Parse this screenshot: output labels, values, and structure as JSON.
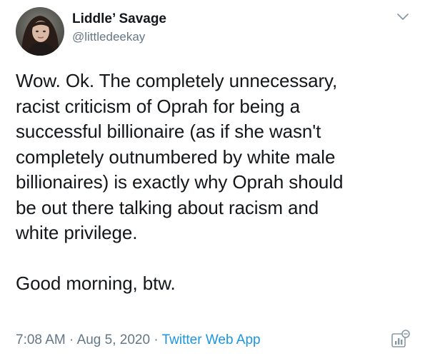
{
  "user": {
    "display_name": "Liddle’ Savage",
    "handle": "@littledeekay",
    "avatar_icon": "avatar-photo"
  },
  "tweet": {
    "lines": [
      "Wow. Ok. The completely unnecessary,",
      "racist criticism of Oprah for being a",
      "successful billionaire (as if she wasn't",
      "completely outnumbered by white male",
      "billionaires) is exactly why Oprah should",
      "be out there talking about racism and",
      "white privilege.",
      "",
      "Good morning, btw."
    ]
  },
  "meta": {
    "time": "7:08 AM",
    "separator": "·",
    "date": "Aug 5, 2020",
    "source": "Twitter Web App"
  },
  "icons": {
    "caret": "chevron-down-icon",
    "analytics": "analytics-icon"
  },
  "colors": {
    "text": "#14171a",
    "secondary": "#657786",
    "link": "#1b95e0"
  }
}
